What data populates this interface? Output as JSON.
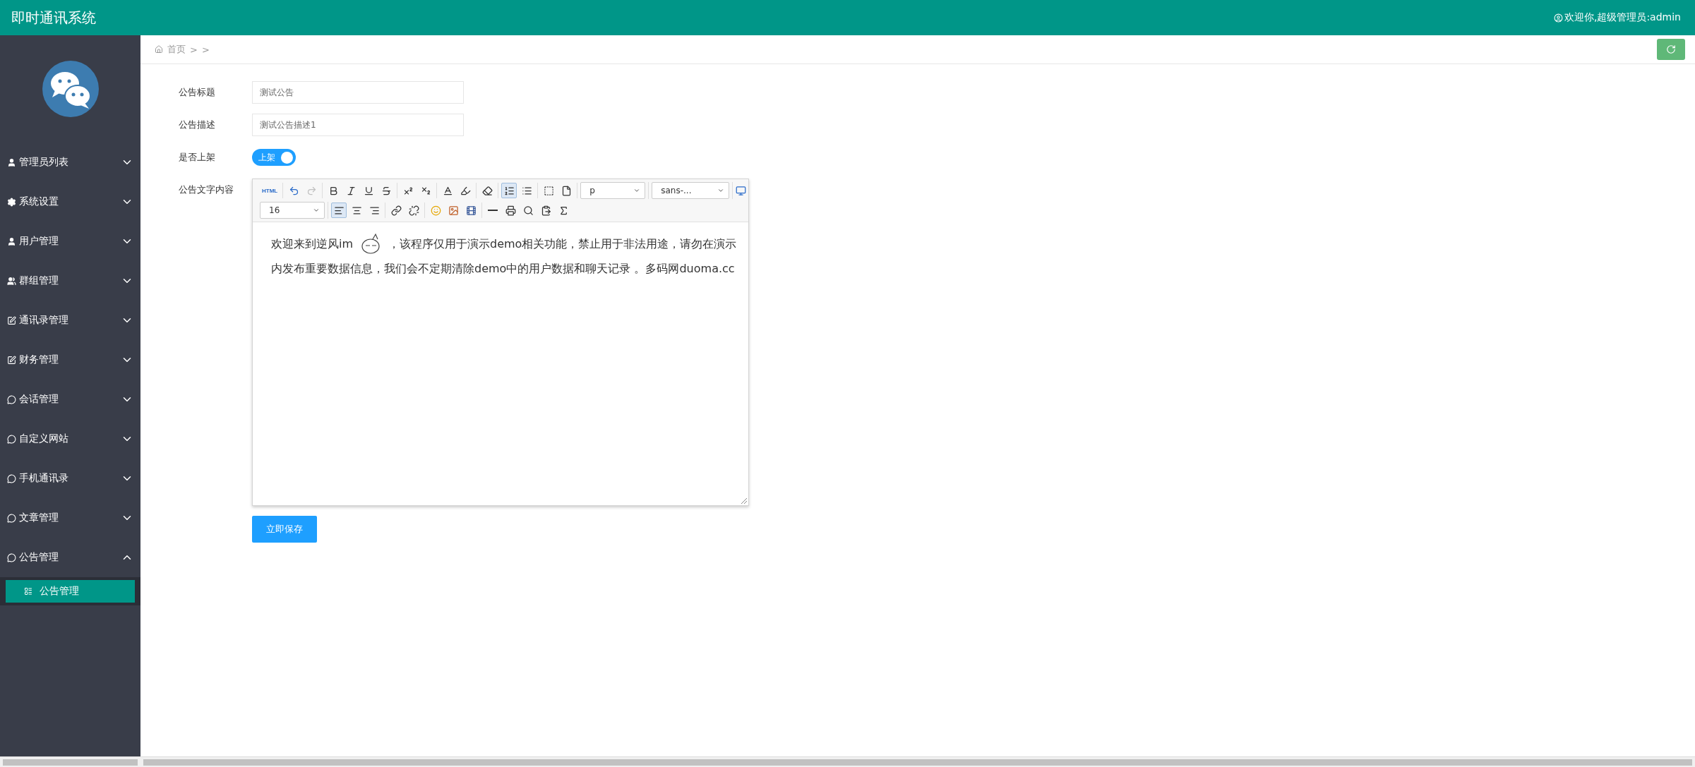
{
  "header": {
    "title": "即时通讯系统",
    "user": "欢迎你,超级管理员:admin"
  },
  "sidebar": {
    "items": [
      {
        "label": "管理员列表",
        "expanded": false
      },
      {
        "label": "系统设置",
        "expanded": false
      },
      {
        "label": "用户管理",
        "expanded": false
      },
      {
        "label": "群组管理",
        "expanded": false
      },
      {
        "label": "通讯录管理",
        "expanded": false
      },
      {
        "label": "财务管理",
        "expanded": false
      },
      {
        "label": "会话管理",
        "expanded": false
      },
      {
        "label": "自定义网站",
        "expanded": false
      },
      {
        "label": "手机通讯录",
        "expanded": false
      },
      {
        "label": "文章管理",
        "expanded": false
      },
      {
        "label": "公告管理",
        "expanded": true,
        "children": [
          {
            "label": "公告管理",
            "selected": true
          }
        ]
      }
    ]
  },
  "breadcrumb": {
    "home": "首页",
    "separators": [
      ">",
      ">"
    ]
  },
  "form": {
    "fields": [
      {
        "kind": "text",
        "label": "公告标题",
        "value": "测试公告"
      },
      {
        "kind": "text",
        "label": "公告描述",
        "value": "测试公告描述1"
      },
      {
        "kind": "switch",
        "label": "是否上架",
        "on": true,
        "text": "上架"
      },
      {
        "kind": "editor",
        "label": "公告文字内容"
      }
    ]
  },
  "editor": {
    "toolbar": [
      [
        [
          {
            "kind": "html",
            "text": "HTML"
          }
        ],
        [
          {
            "kind": "undo",
            "disabled": false
          },
          {
            "kind": "redo",
            "disabled": true
          }
        ],
        [
          {
            "kind": "bold"
          },
          {
            "kind": "italic"
          },
          {
            "kind": "underline"
          },
          {
            "kind": "strike"
          }
        ],
        [
          {
            "kind": "superscript"
          },
          {
            "kind": "subscript"
          }
        ],
        [
          {
            "kind": "font-color"
          },
          {
            "kind": "highlight"
          }
        ],
        [
          {
            "kind": "eraser"
          }
        ],
        [
          {
            "kind": "ordered-list",
            "active": true
          },
          {
            "kind": "unordered-list",
            "active": false
          }
        ],
        [
          {
            "kind": "blockquote"
          },
          {
            "kind": "page"
          }
        ],
        [
          {
            "kind": "select",
            "value": "p"
          }
        ],
        [
          {
            "kind": "select",
            "value": "sans-..."
          }
        ]
      ],
      [
        [
          {
            "kind": "select",
            "value": "16"
          }
        ],
        [
          {
            "kind": "align-left",
            "active": true
          },
          {
            "kind": "align-center",
            "active": false
          },
          {
            "kind": "align-right",
            "active": false
          }
        ],
        [
          {
            "kind": "link"
          },
          {
            "kind": "unlink"
          }
        ],
        [
          {
            "kind": "emoticon"
          },
          {
            "kind": "image"
          },
          {
            "kind": "video"
          }
        ],
        [
          {
            "kind": "rule"
          },
          {
            "kind": "print"
          },
          {
            "kind": "preview"
          },
          {
            "kind": "paste"
          },
          {
            "kind": "formula"
          }
        ]
      ]
    ],
    "content_before": "欢迎来到逆风im",
    "content_after": "，该程序仅用于演示demo相关功能，禁止用于非法用途，请勿在演示内发布重要数据信息，我们会不定期清除demo中的用户数据和聊天记录 。多码网duoma.cc"
  },
  "save_button": "立即保存"
}
